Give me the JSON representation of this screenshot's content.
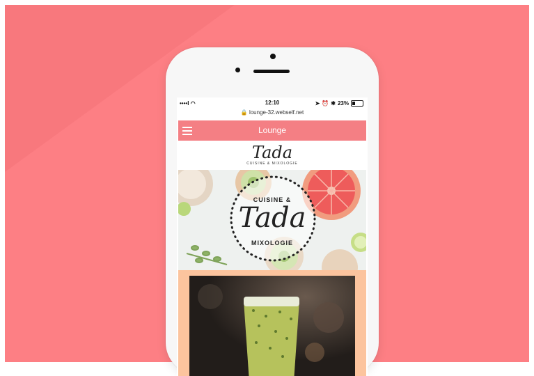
{
  "statusbar": {
    "signal": "••••l ◠",
    "time": "12:10",
    "battery_text": "23%"
  },
  "browser": {
    "url": "🔒 lounge-32.webself.net"
  },
  "nav": {
    "title": "Lounge"
  },
  "logo": {
    "script": "Tada",
    "subtitle": "CUISINE & MIXOLOGIE"
  },
  "hero": {
    "badge_top": "CUISINE &",
    "badge_script": "Tada",
    "badge_bottom": "MIXOLOGIE"
  },
  "colors": {
    "background": "#fd7f84",
    "nav": "#f47f84",
    "peach": "#fcc49e"
  }
}
